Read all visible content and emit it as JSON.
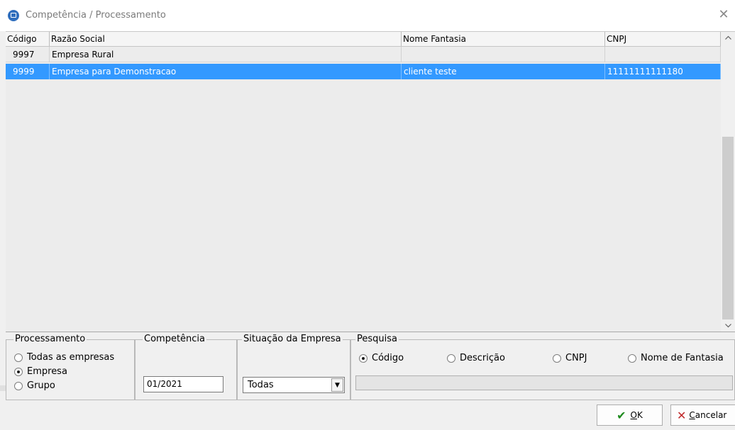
{
  "window": {
    "title": "Competência / Processamento",
    "close_glyph": "✕"
  },
  "grid": {
    "columns": [
      "Código",
      "Razão Social",
      "Nome Fantasia",
      "CNPJ"
    ],
    "rows": [
      {
        "codigo": "9997",
        "razao": "Empresa Rural",
        "fantasia": "",
        "cnpj": "",
        "selected": false
      },
      {
        "codigo": "9999",
        "razao": "Empresa para Demonstracao",
        "fantasia": "cliente teste",
        "cnpj": "11111111111180",
        "selected": true
      }
    ],
    "scroll_up": "^",
    "scroll_down": "v"
  },
  "processamento": {
    "label": "Processamento",
    "options": [
      "Todas as empresas",
      "Empresa",
      "Grupo"
    ],
    "selected": "Empresa"
  },
  "competencia": {
    "label": "Competência",
    "value": "01/2021"
  },
  "situacao": {
    "label": "Situação da Empresa",
    "value": "Todas",
    "arrow": "▼"
  },
  "pesquisa": {
    "label": "Pesquisa",
    "options": [
      "Código",
      "Descrição",
      "CNPJ",
      "Nome de Fantasia"
    ],
    "selected": "Código",
    "search_value": ""
  },
  "buttons": {
    "ok_check": "✔",
    "ok_underline": "O",
    "ok_rest": "K",
    "cancel_x": "✕",
    "cancel_underline": "C",
    "cancel_rest": "ancelar"
  },
  "colors": {
    "selection": "#3399ff",
    "ok_icon": "#1e8a1e",
    "cancel_icon": "#c0292b"
  }
}
